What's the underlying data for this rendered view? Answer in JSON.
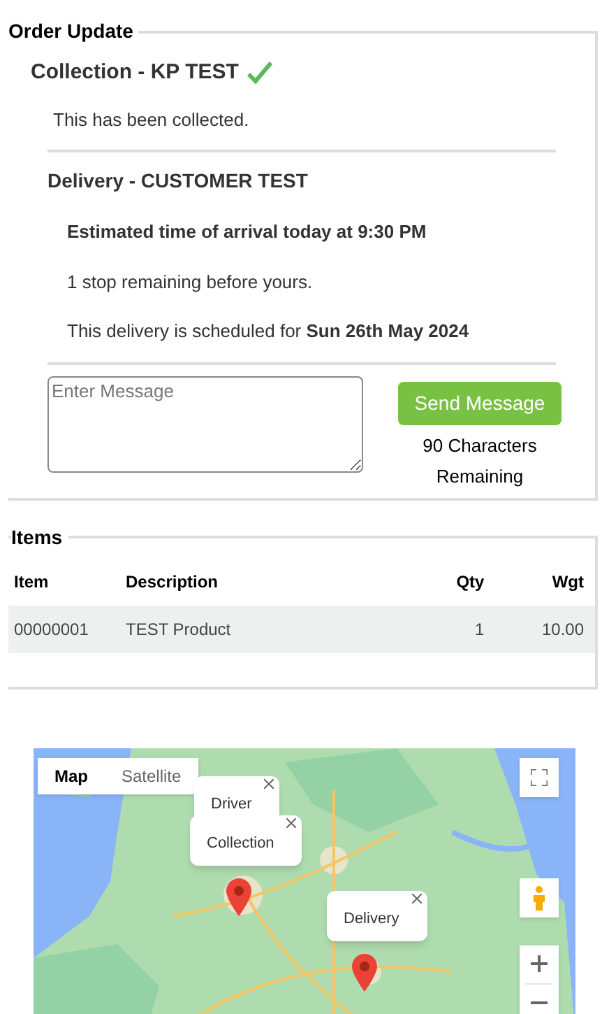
{
  "order_update": {
    "legend": "Order Update",
    "collection": {
      "title": "Collection - KP TEST",
      "done": true,
      "status": "This has been collected."
    },
    "delivery": {
      "title": "Delivery - CUSTOMER TEST",
      "eta": "Estimated time of arrival today at 9:30 PM",
      "stops": "1 stop remaining before yours.",
      "scheduled": "This delivery is scheduled for **Sun 26th May 2024**"
    },
    "message": {
      "placeholder": "Enter Message",
      "button": "Send Message",
      "remaining": "90 Characters Remaining"
    }
  },
  "items": {
    "legend": "Items",
    "columns": [
      "Item",
      "Description",
      "Qty",
      "Wgt"
    ],
    "rows": [
      [
        "00000001",
        "TEST Product",
        "1",
        "10.00"
      ]
    ]
  },
  "map": {
    "tabs": [
      {
        "label": "Map",
        "selected": true
      },
      {
        "label": "Satellite",
        "selected": false
      }
    ],
    "markers": [
      {
        "label": "Driver",
        "kind": "label"
      },
      {
        "label": "Collection",
        "kind": "pin"
      },
      {
        "label": "Delivery",
        "kind": "pin"
      }
    ]
  }
}
